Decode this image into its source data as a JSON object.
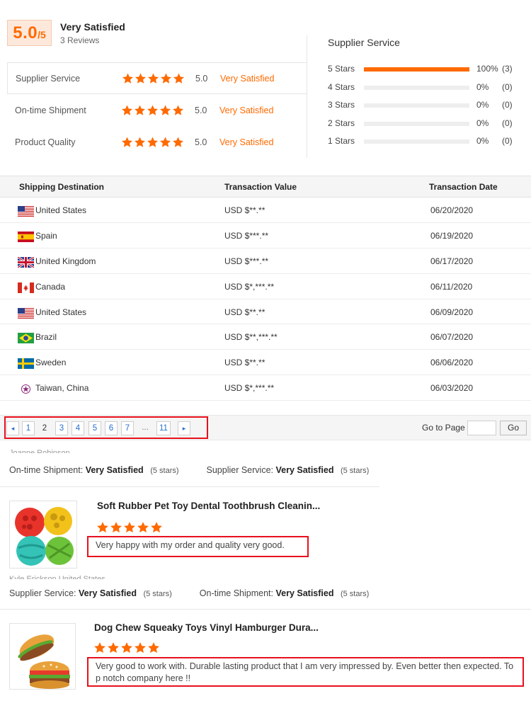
{
  "summary": {
    "score": "5.0",
    "score_suffix": "/5",
    "overall_label": "Very Satisfied",
    "reviews_count": "3 Reviews",
    "ratings": [
      {
        "label": "Supplier Service",
        "value": "5.0",
        "text": "Very Satisfied",
        "stars": 5
      },
      {
        "label": "On-time Shipment",
        "value": "5.0",
        "text": "Very Satisfied",
        "stars": 5
      },
      {
        "label": "Product Quality",
        "value": "5.0",
        "text": "Very Satisfied",
        "stars": 5
      }
    ],
    "distribution": {
      "title": "Supplier Service",
      "rows": [
        {
          "label": "5 Stars",
          "percent": "100%",
          "count": "(3)",
          "fill": 1.0
        },
        {
          "label": "4 Stars",
          "percent": "0%",
          "count": "(0)",
          "fill": 0
        },
        {
          "label": "3 Stars",
          "percent": "0%",
          "count": "(0)",
          "fill": 0
        },
        {
          "label": "2 Stars",
          "percent": "0%",
          "count": "(0)",
          "fill": 0
        },
        {
          "label": "1 Stars",
          "percent": "0%",
          "count": "(0)",
          "fill": 0
        }
      ],
      "bar_color": "#ff6a00"
    }
  },
  "transactions": {
    "headers": {
      "destination": "Shipping Destination",
      "value": "Transaction Value",
      "date": "Transaction Date"
    },
    "rows": [
      {
        "flag": "us-flag-icon",
        "destination": "United States",
        "value": "USD $**.**",
        "date": "06/20/2020"
      },
      {
        "flag": "es-flag-icon",
        "destination": "Spain",
        "value": "USD $***.**",
        "date": "06/19/2020"
      },
      {
        "flag": "gb-flag-icon",
        "destination": "United Kingdom",
        "value": "USD $***.**",
        "date": "06/17/2020"
      },
      {
        "flag": "ca-flag-icon",
        "destination": "Canada",
        "value": "USD $*,***.**",
        "date": "06/11/2020"
      },
      {
        "flag": "us-flag-icon",
        "destination": "United States",
        "value": "USD $**.**",
        "date": "06/09/2020"
      },
      {
        "flag": "br-flag-icon",
        "destination": "Brazil",
        "value": "USD $**,***.**",
        "date": "06/07/2020"
      },
      {
        "flag": "se-flag-icon",
        "destination": "Sweden",
        "value": "USD $**.**",
        "date": "06/06/2020"
      },
      {
        "flag": "tw-emblem-icon",
        "destination": "Taiwan, China",
        "value": "USD $*,***.**",
        "date": "06/03/2020"
      }
    ]
  },
  "pagination": {
    "prev": "◂",
    "next": "▸",
    "pages": [
      "1",
      "2",
      "3",
      "4",
      "5",
      "6",
      "7"
    ],
    "current": "2",
    "ellipsis": "...",
    "last": "11",
    "goto_label": "Go to Page",
    "goto_value": "",
    "goto_button": "Go"
  },
  "reviews": [
    {
      "reviewer": "Joanne Robinson",
      "meta": [
        {
          "label": "On-time Shipment:",
          "value": "Very Satisfied",
          "stars": "(5 stars)"
        },
        {
          "label": "Supplier Service:",
          "value": "Very Satisfied",
          "stars": "(5 stars)"
        }
      ]
    },
    {
      "product_title": "Soft Rubber Pet Toy Dental Toothbrush Cleanin...",
      "product_image": "rubber-ball-toys-image",
      "rating": 5,
      "text": "Very happy with my order and quality very good.",
      "reviewer": "Kyle Erickson,United States",
      "meta": [
        {
          "label": "Supplier Service:",
          "value": "Very Satisfied",
          "stars": "(5 stars)"
        },
        {
          "label": "On-time Shipment:",
          "value": "Very Satisfied",
          "stars": "(5 stars)"
        }
      ]
    },
    {
      "product_title": "Dog Chew Squeaky Toys Vinyl Hamburger Dura...",
      "product_image": "hamburger-toy-image",
      "rating": 5,
      "text": "Very good to work with. Durable lasting product that I am very impressed by. Even better then expected. To p notch company here !!"
    }
  ],
  "colors": {
    "accent": "#ff6a00",
    "highlight_box": "#e8101e",
    "link": "#2a6fcc"
  }
}
